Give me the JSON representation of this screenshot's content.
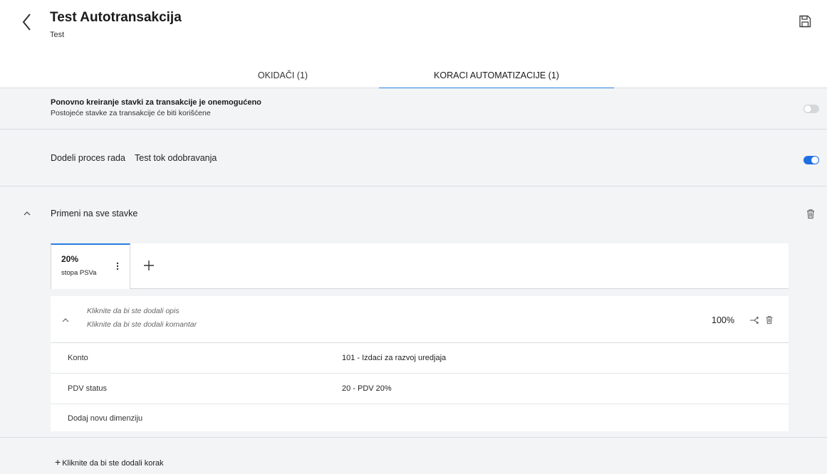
{
  "header": {
    "title": "Test Autotransakcija",
    "subtitle": "Test",
    "back_icon": "chevron-left-icon",
    "save_icon": "floppy-disk-icon"
  },
  "tabs": [
    {
      "label": "OKIDAČI (1)",
      "active": false
    },
    {
      "label": "KORACI AUTOMATIZACIJE (1)",
      "active": true
    }
  ],
  "settings": {
    "recreate": {
      "title": "Ponovno kreiranje stavki za transakcije je onemogućeno",
      "subtitle": "Postojeće stavke za transakcije će biti korišćene",
      "enabled": false
    },
    "workflow": {
      "label": "Dodeli proces rada",
      "value": "Test tok odobravanja",
      "enabled": true
    }
  },
  "section": {
    "title": "Primeni na sve stavke",
    "expanded": true,
    "rate_tab": {
      "value": "20%",
      "name": "stopa PSVa"
    },
    "add_label": "+"
  },
  "step": {
    "description_placeholder": "Kliknite da bi ste dodali opis",
    "comment_placeholder": "Kliknite da bi ste dodali komantar",
    "percent": "100%",
    "dimensions": [
      {
        "key": "Konto",
        "value": "101 - Izdaci za razvoj uredjaja"
      },
      {
        "key": "PDV status",
        "value": "20 - PDV 20%"
      }
    ],
    "add_dimension": "Dodaj novu dimenziju"
  },
  "footer": {
    "add_step": "Kliknite da bi ste dodali korak"
  },
  "colors": {
    "accent": "#2a7de1",
    "toggle_on": "#1f6fe0",
    "toggle_off": "#d5d8db",
    "background": "#f3f4f5"
  }
}
